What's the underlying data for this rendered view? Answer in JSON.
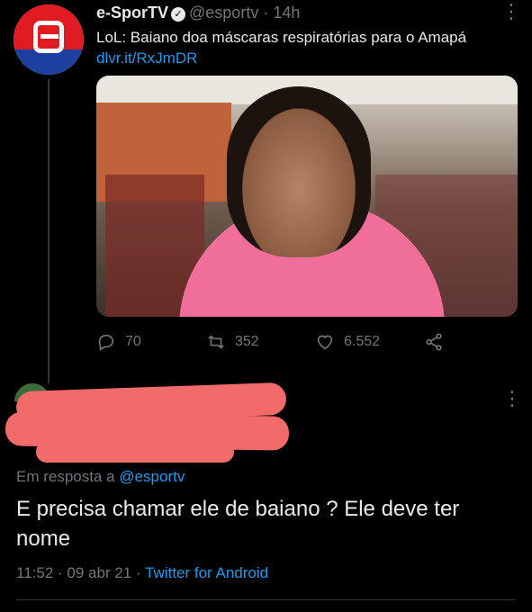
{
  "tweet": {
    "author_name": "e-SporTV",
    "verified_glyph": "✓",
    "handle": "@esportv",
    "separator": "·",
    "time": "14h",
    "text": "LoL: Baiano doa máscaras respiratórias para o Amapá",
    "link": "dlvr.it/RxJmDR",
    "actions": {
      "replies": "70",
      "retweets": "352",
      "likes": "6.552"
    },
    "icons": {
      "more": "more-vertical-icon",
      "reply": "reply-icon",
      "retweet": "retweet-icon",
      "like": "heart-icon",
      "share": "share-icon"
    }
  },
  "reply": {
    "reply_prefix": "Em resposta a",
    "reply_handle": "@esportv",
    "text": "E precisa chamar ele de baiano ? Ele deve ter nome",
    "time": "11:52",
    "date": "09 abr 21",
    "separator": "·",
    "source": "Twitter for Android"
  },
  "colors": {
    "background": "#000000",
    "text": "#e7e9ea",
    "muted": "#71767b",
    "link": "#1d9bf0",
    "redaction": "#f16b6b"
  }
}
